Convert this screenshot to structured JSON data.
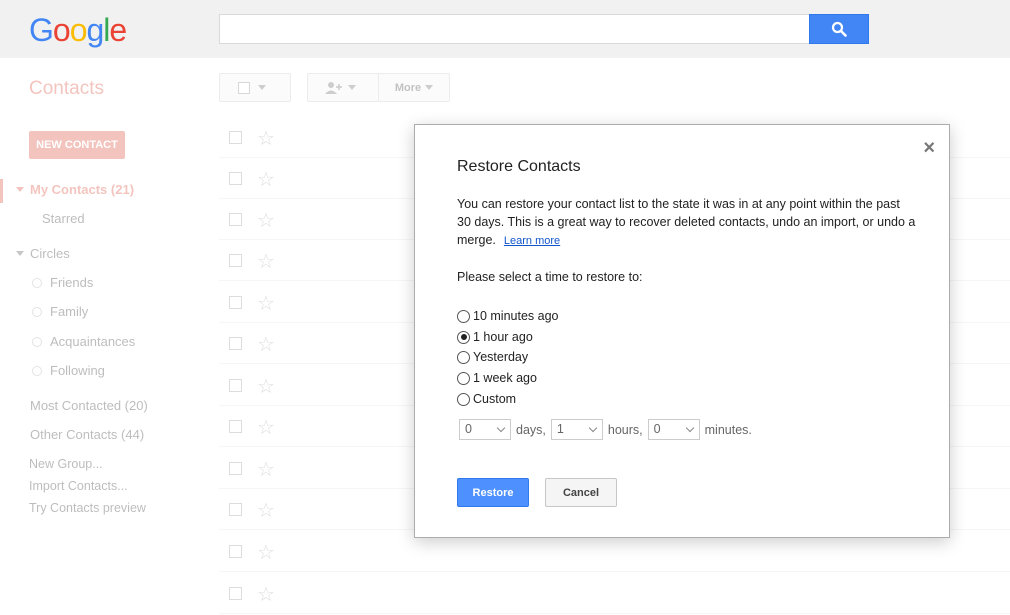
{
  "header": {
    "logo_letters": [
      "G",
      "o",
      "o",
      "g",
      "l",
      "e"
    ],
    "logo_colors": [
      "#4285f4",
      "#ea4335",
      "#fbbc05",
      "#4285f4",
      "#34a853",
      "#ea4335"
    ],
    "search_value": "",
    "search_icon": "search-icon"
  },
  "app": {
    "title": "Contacts",
    "toolbar": {
      "select_icon": "checkbox-icon",
      "add_icon": "add-person-icon",
      "more_label": "More"
    }
  },
  "sidebar": {
    "new_contact": "NEW CONTACT",
    "my_contacts": "My Contacts (21)",
    "starred": "Starred",
    "circles": "Circles",
    "circle_items": [
      "Friends",
      "Family",
      "Acquaintances",
      "Following"
    ],
    "most_contacted": "Most Contacted (20)",
    "other_contacts": "Other Contacts (44)",
    "new_group": "New Group...",
    "import_contacts": "Import Contacts...",
    "try_preview": "Try Contacts preview"
  },
  "dialog": {
    "title": "Restore Contacts",
    "description": "You can restore your contact list to the state it was in at any point within the past 30 days. This is a great way to recover deleted contacts, undo an import, or undo a merge.",
    "learn_more": "Learn more",
    "prompt": "Please select a time to restore to:",
    "options": [
      "10 minutes ago",
      "1 hour ago",
      "Yesterday",
      "1 week ago",
      "Custom"
    ],
    "selected_option": "1 hour ago",
    "custom": {
      "days_value": "0",
      "days_label": "days,",
      "hours_value": "1",
      "hours_label": "hours,",
      "minutes_value": "0",
      "minutes_label": "minutes."
    },
    "restore_label": "Restore",
    "cancel_label": "Cancel",
    "close_symbol": "×"
  },
  "colors": {
    "accent_red": "#dd4b39",
    "accent_blue": "#4d90fe"
  }
}
